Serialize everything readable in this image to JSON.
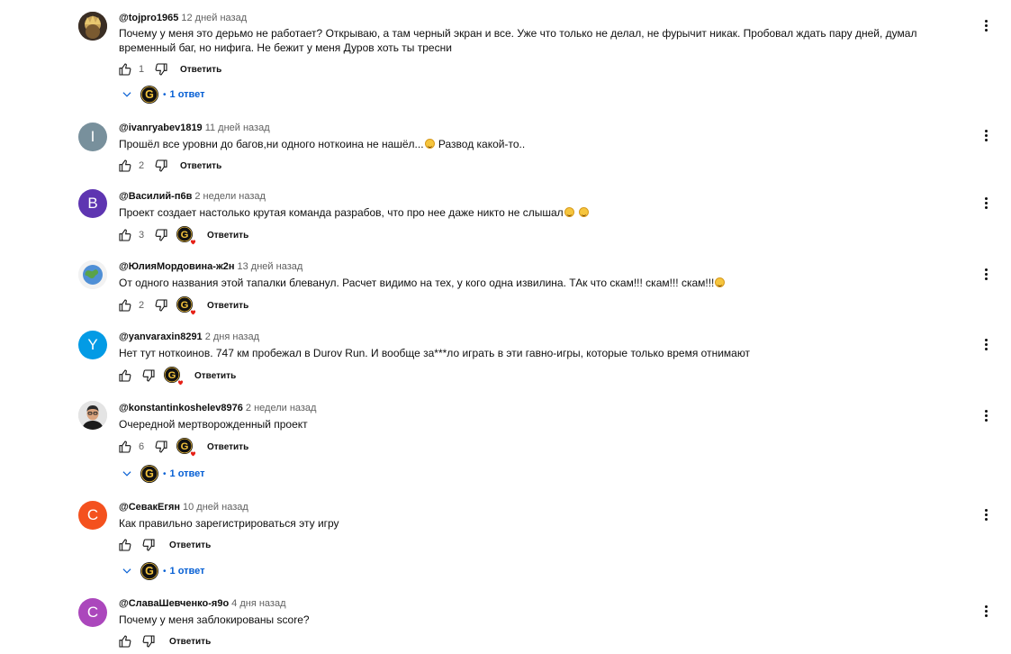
{
  "colors": {
    "link_blue": "#065fd4",
    "meta_gray": "#606060",
    "text": "#0f0f0f",
    "heart_red": "#e62117"
  },
  "icons": {
    "like": "thumb-up-outline-icon",
    "dislike": "thumb-down-outline-icon",
    "more": "three-dot-vertical-icon",
    "chevron": "chevron-down-icon",
    "creator_heart": "creator-heart-icon",
    "creator_avatar": "g-logo-icon"
  },
  "reply_label": "Ответить",
  "comments": [
    {
      "author": "@tojpro1965",
      "time": "12 дней назад",
      "text": "Почему у меня это дерьмо не работает? Открываю, а там черный экран и все. Уже что только не делал, не фурычит никак. Пробовал ждать пару дней, думал временный баг, но нифига. Не бежит у меня Дуров хоть ты тресни",
      "likes": "1",
      "replies_label": "1 ответ",
      "avatar_color": "#5a4a3a",
      "avatar_letter": ""
    },
    {
      "author": "@ivanryabev1819",
      "time": "11 дней назад",
      "text": "Прошёл все уровни до багов,ни одного ноткоина не нашёл...",
      "text_after": " Развод какой-то..",
      "likes": "2",
      "avatar_color": "#78909c",
      "avatar_letter": "I"
    },
    {
      "author": "@Василий-п6в",
      "time": "2 недели назад",
      "text": "Проект создает настолько крутая команда разрабов, что про нее даже никто не слышал",
      "likes": "3",
      "avatar_color": "#5e35b1",
      "avatar_letter": "B"
    },
    {
      "author": "@ЮлияМордовина-ж2н",
      "time": "13 дней назад",
      "text": "От одного названия этой тапалки блеванул. Расчет видимо на тех, у кого одна извилина. ТАк что скам!!! скам!!! скам!!!",
      "likes": "2",
      "avatar_color": "#6fa8dc",
      "avatar_letter": ""
    },
    {
      "author": "@yanvaraxin8291",
      "time": "2 дня назад",
      "text": "Нет тут ноткоинов. 747 км пробежал в Durov Run. И вообще за***ло играть в эти гавно-игры, которые только время отнимают",
      "likes": "",
      "avatar_color": "#039be5",
      "avatar_letter": "Y"
    },
    {
      "author": "@konstantinkoshelev8976",
      "time": "2 недели назад",
      "text": "Очередной мертворожденный проект",
      "likes": "6",
      "replies_label": "1 ответ",
      "avatar_color": "#3b3b3b",
      "avatar_letter": ""
    },
    {
      "author": "@СевакЕгян",
      "time": "10 дней назад",
      "text": "Как правильно зарегистрироваться эту игру",
      "likes": "",
      "replies_label": "1 ответ",
      "avatar_color": "#f4511e",
      "avatar_letter": "C"
    },
    {
      "author": "@СлаваШевченко-я9о",
      "time": "4 дня назад",
      "text": "Почему у меня заблокированы score?",
      "likes": "",
      "avatar_color": "#ab47bc",
      "avatar_letter": "C"
    }
  ]
}
